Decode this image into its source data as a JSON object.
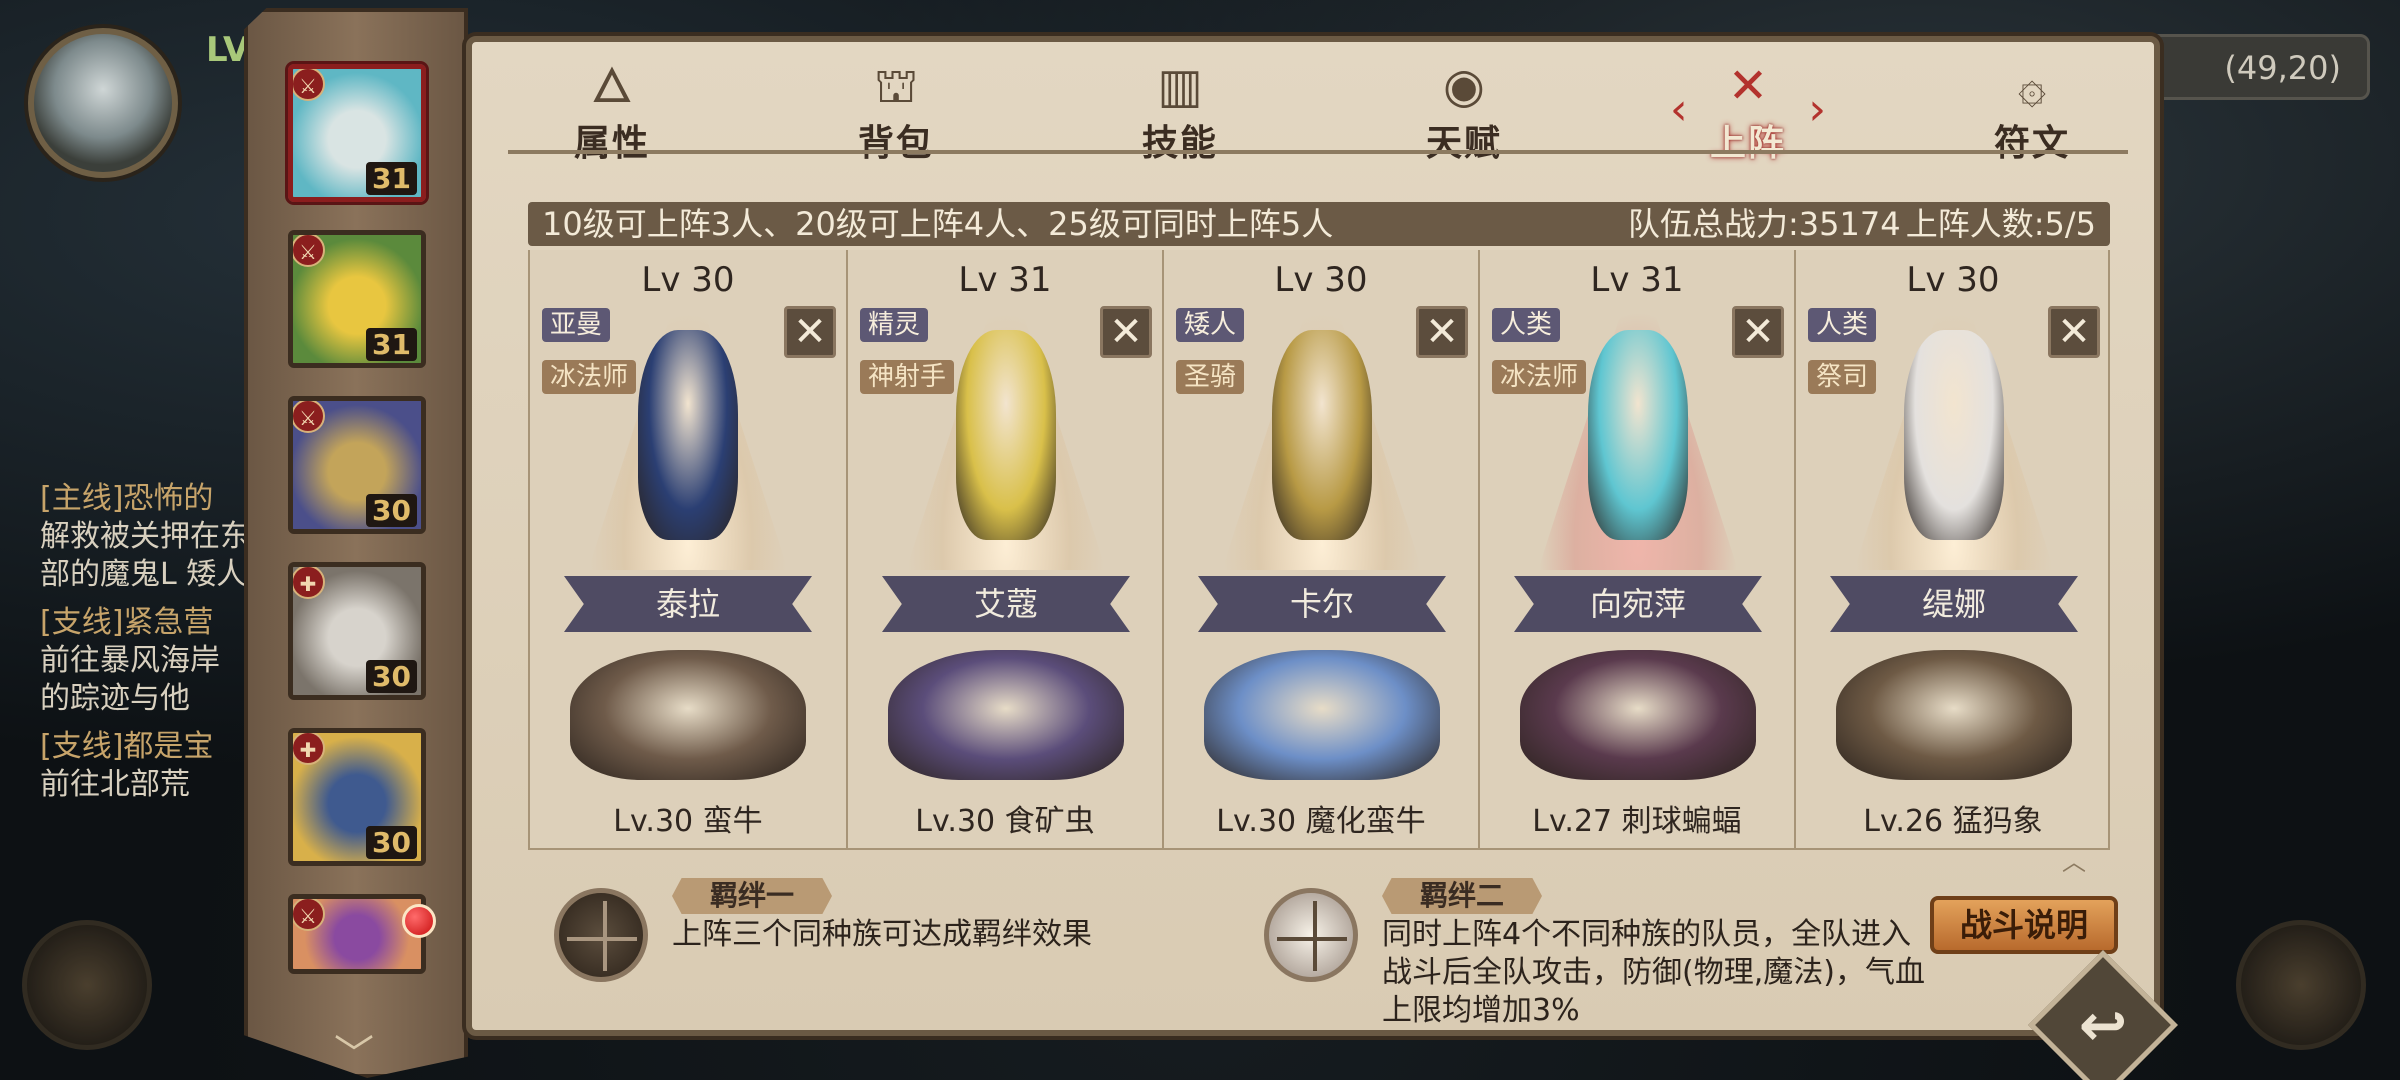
{
  "background": {
    "level_text": "LV",
    "coordinates": "(49,20)",
    "quests": [
      {
        "title": "[主线]恐怖的",
        "text": "解救被关押在东部的魔鬼L 矮人"
      },
      {
        "title": "[支线]紧急营",
        "text": "前往暴风海岸 的踪迹与他"
      },
      {
        "title": "[支线]都是宝",
        "text": "前往北部荒"
      }
    ]
  },
  "hero_list": {
    "items": [
      {
        "level": "31",
        "class_icon": "sword-icon",
        "selected": true,
        "colors": [
          "#d9e4e3",
          "#5fb7c4"
        ]
      },
      {
        "level": "31",
        "class_icon": "sword-icon",
        "selected": false,
        "colors": [
          "#e8c640",
          "#5b8a3c"
        ]
      },
      {
        "level": "30",
        "class_icon": "sword-icon",
        "selected": false,
        "colors": [
          "#c3a45a",
          "#4b4f8a"
        ]
      },
      {
        "level": "30",
        "class_icon": "cross-icon",
        "selected": false,
        "colors": [
          "#d7d3cc",
          "#7b746b"
        ]
      },
      {
        "level": "30",
        "class_icon": "cross-icon",
        "selected": false,
        "colors": [
          "#3f5a8f",
          "#d8b04a"
        ]
      },
      {
        "level": "",
        "class_icon": "sword-icon",
        "selected": false,
        "colors": [
          "#8a4aa0",
          "#d99062"
        ]
      }
    ],
    "has_notification": true
  },
  "tabs": [
    {
      "label": "属性",
      "icon": "flame-icon",
      "active": false
    },
    {
      "label": "背包",
      "icon": "bag-icon",
      "active": false
    },
    {
      "label": "技能",
      "icon": "book-icon",
      "active": false
    },
    {
      "label": "天赋",
      "icon": "eye-icon",
      "active": false
    },
    {
      "label": "上阵",
      "icon": "crossed-swords-icon",
      "active": true
    },
    {
      "label": "符文",
      "icon": "rune-icon",
      "active": false
    }
  ],
  "info_bar": {
    "rule": "10级可上阵3人、20级可上阵4人、25级可同时上阵5人",
    "team_power": "队伍总战力:35174",
    "count": "上阵人数:5/5"
  },
  "team": [
    {
      "level": "Lv 30",
      "race": "亚曼",
      "class": "冰法师",
      "name": "泰拉",
      "pet": "Lv.30 蛮牛",
      "spot": "normal",
      "hero_color": "#2b3f73",
      "pet_color": "#6f5b4a"
    },
    {
      "level": "Lv 31",
      "race": "精灵",
      "class": "神射手",
      "name": "艾蔻",
      "pet": "Lv.30 食矿虫",
      "spot": "normal",
      "hero_color": "#d9c04a",
      "pet_color": "#5b4d7a"
    },
    {
      "level": "Lv 30",
      "race": "矮人",
      "class": "圣骑",
      "name": "卡尔",
      "pet": "Lv.30 魔化蛮牛",
      "spot": "normal",
      "hero_color": "#b89a45",
      "pet_color": "#6d8fc7"
    },
    {
      "level": "Lv 31",
      "race": "人类",
      "class": "冰法师",
      "name": "向宛萍",
      "pet": "Lv.27 刺球蝙蝠",
      "spot": "red",
      "hero_color": "#5fc6d1",
      "pet_color": "#5a3a4d"
    },
    {
      "level": "Lv 30",
      "race": "人类",
      "class": "祭司",
      "name": "缇娜",
      "pet": "Lv.26 猛犸象",
      "spot": "normal",
      "hero_color": "#e4e1de",
      "pet_color": "#6e5a45"
    }
  ],
  "bonds": [
    {
      "title": "羁绊一",
      "desc": [
        "上阵三个同种族可达成羁绊效果"
      ],
      "active": false
    },
    {
      "title": "羁绊二",
      "desc": [
        "同时上阵4个不同种族的队员，全队进入",
        "战斗后全队攻击，防御(物理,魔法)，气血",
        "上限均增加3%"
      ],
      "active": true
    }
  ],
  "buttons": {
    "battle_help": "战斗说明",
    "back": "↩"
  }
}
